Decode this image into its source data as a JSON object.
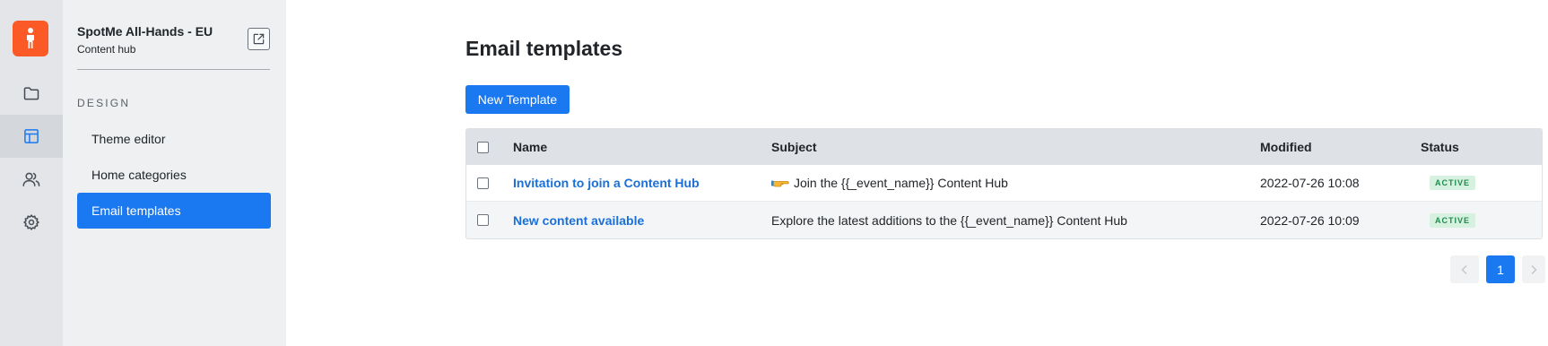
{
  "app": {
    "event_name": "SpotMe All-Hands - EU",
    "event_subtitle": "Content hub",
    "brand_color": "#fb5a26",
    "accent_color": "#1a78f0"
  },
  "rail": {
    "items": [
      {
        "icon": "folder-icon",
        "active": false
      },
      {
        "icon": "layout-icon",
        "active": true
      },
      {
        "icon": "users-icon",
        "active": false
      },
      {
        "icon": "gear-icon",
        "active": false
      }
    ]
  },
  "sidebar": {
    "section_heading": "DESIGN",
    "items": [
      {
        "label": "Theme editor",
        "active": false
      },
      {
        "label": "Home categories",
        "active": false
      },
      {
        "label": "Email templates",
        "active": true
      }
    ]
  },
  "main": {
    "title": "Email templates",
    "new_button_label": "New Template",
    "table": {
      "columns": [
        "Name",
        "Subject",
        "Modified",
        "Status"
      ],
      "rows": [
        {
          "name": "Invitation to join a Content Hub",
          "subject_icon": "pointing-hand-emoji",
          "subject": "Join the {{_event_name}} Content Hub",
          "modified": "2022-07-26 10:08",
          "status": "ACTIVE"
        },
        {
          "name": "New content available",
          "subject": "Explore the latest additions to the {{_event_name}} Content Hub",
          "modified": "2022-07-26 10:09",
          "status": "ACTIVE"
        }
      ]
    },
    "pagination": {
      "current_page": "1",
      "prev_icon": "chevron-left-icon",
      "next_icon": "chevron-right-icon"
    }
  }
}
